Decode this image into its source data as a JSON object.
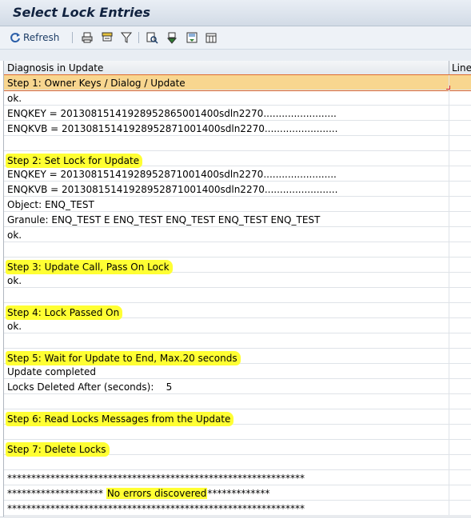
{
  "window": {
    "title": "Select Lock Entries"
  },
  "toolbar": {
    "refresh_label": "Refresh",
    "icons": [
      "refresh-icon",
      "print-icon",
      "print-preview-icon",
      "filter-icon",
      "find-icon",
      "export-icon",
      "save-icon",
      "layout-icon"
    ]
  },
  "grid": {
    "col_diagnosis": "Diagnosis in Update",
    "col_line": "Line",
    "rows": [
      {
        "text": "Step 1: Owner Keys / Dialog / Update",
        "kind": "selected"
      },
      {
        "text": "ok."
      },
      {
        "text": "ENQKEY = 20130815141928952865001400sdln2270........................"
      },
      {
        "text": "ENQKVB = 20130815141928952871001400sdln2270........................"
      },
      {
        "text": ""
      },
      {
        "text": "Step 2: Set Lock for Update",
        "kind": "highlight"
      },
      {
        "text": "ENQKEY = 20130815141928952871001400sdln2270........................"
      },
      {
        "text": "ENQKVB = 20130815141928952871001400sdln2270........................"
      },
      {
        "text": "Object: ENQ_TEST"
      },
      {
        "text": "Granule: ENQ_TEST E ENQ_TEST ENQ_TEST ENQ_TEST ENQ_TEST"
      },
      {
        "text": "ok."
      },
      {
        "text": ""
      },
      {
        "text": "Step 3: Update Call, Pass On Lock",
        "kind": "highlight"
      },
      {
        "text": "ok."
      },
      {
        "text": ""
      },
      {
        "text": "Step 4: Lock Passed On",
        "kind": "highlight"
      },
      {
        "text": "ok."
      },
      {
        "text": ""
      },
      {
        "text": "Step 5: Wait for Update to End, Max.20 seconds",
        "kind": "highlight"
      },
      {
        "text": "Update completed"
      },
      {
        "text": "Locks Deleted After (seconds):    5"
      },
      {
        "text": ""
      },
      {
        "text": "Step 6: Read Locks Messages from the Update",
        "kind": "highlight"
      },
      {
        "text": ""
      },
      {
        "text": "Step 7: Delete Locks",
        "kind": "highlight"
      },
      {
        "text": ""
      },
      {
        "text": "**************************************************************"
      },
      {
        "text": "******************** ",
        "mid": "No errors discovered",
        "post": "*************",
        "kind": "inline"
      },
      {
        "text": "**************************************************************"
      }
    ]
  },
  "colors": {
    "highlight": "#ffff33",
    "selected_row": "#f8d68f",
    "selection_border": "#e06a2d"
  }
}
